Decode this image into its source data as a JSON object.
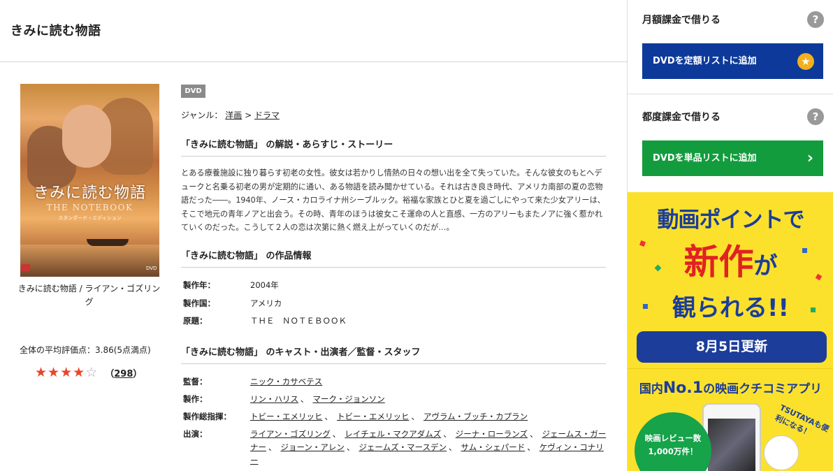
{
  "page_title": "きみに読む物語",
  "poster": {
    "title": "きみに読む物語",
    "subtitle": "THE NOTEBOOK",
    "edition": "スタンダード・エディション",
    "caption": "きみに読む物語 / ライアン・ゴズリング"
  },
  "rating": {
    "average_text": "全体の平均評価点：3.86(5点満点)",
    "average": 3.86,
    "count_open": "（",
    "count": "298",
    "count_close": "）"
  },
  "media_tag": "DVD",
  "genre": {
    "label": "ジャンル：",
    "items": [
      "洋画",
      "ドラマ"
    ],
    "sep": " > "
  },
  "synopsis": {
    "heading": "「きみに読む物語」 の解説・あらすじ・ストーリー",
    "text": "とある療養施設に独り暮らす初老の女性。彼女は若かりし情熱の日々の想い出を全て失っていた。そんな彼女のもとへデュークと名乗る初老の男が定期的に通い、ある物語を読み聞かせている。それは古き良き時代、アメリカ南部の夏の恋物語だった――。1940年、ノース・カロライナ州シーブルック。裕福な家族とひと夏を過ごしにやって来た少女アリーは、そこで地元の青年ノアと出会う。その時、青年のほうは彼女こそ運命の人と直感、一方のアリーもまたノアに強く惹かれていくのだった。こうして２人の恋は次第に熱く燃え上がっていくのだが…。"
  },
  "info": {
    "heading": "「きみに読む物語」 の作品情報",
    "rows": [
      {
        "label": "製作年：",
        "value": "2004年"
      },
      {
        "label": "製作国：",
        "value": "アメリカ"
      },
      {
        "label": "原題：",
        "value": "ＴＨＥ　ＮＯＴＥＢＯＯＫ"
      }
    ]
  },
  "cast": {
    "heading": "「きみに読む物語」 のキャスト・出演者／監督・スタッフ",
    "director_label": "監督：",
    "director": [
      "ニック・カサベテス"
    ],
    "producer_label": "製作：",
    "producers": [
      "リン・ハリス",
      "マーク・ジョンソン"
    ],
    "exec_label": "製作総指揮：",
    "execs": [
      "トビー・エメリッヒ",
      "トビー・エメリッヒ",
      "アヴラム・ブッチ・カプラン"
    ],
    "cast_label": "出演：",
    "actors": [
      "ライアン・ゴズリング",
      "レイチェル・マクアダムズ",
      "ジーナ・ローランズ",
      "ジェームス・ガーナー",
      "ジョーン・アレン",
      "ジェームズ・マースデン",
      "サム・シェパード",
      "ケヴィン・コナリー"
    ],
    "separator": "、"
  },
  "sidebar": {
    "monthly_title": "月額課金で借りる",
    "monthly_button": "DVDを定額リストに追加",
    "single_title": "都度課金で借りる",
    "single_button": "DVDを単品リストに追加",
    "help_glyph": "?",
    "colors": {
      "blue": "#0d3a9a",
      "green": "#139c3d",
      "star": "#f2b01e"
    }
  },
  "ads": {
    "banner1_line1": "動画ポイントで",
    "banner1_line2": "新作",
    "banner1_line2b": "が",
    "banner1_line3": "観られる!!",
    "banner1_update": "8月5日更新",
    "banner2_prefix": "国内",
    "banner2_no1": "No.1",
    "banner2_suffix": "の映画クチコミアプリ",
    "banner2_circle_line1": "映画レビュー数",
    "banner2_circle_line2": "1,000万件！",
    "banner2_bubble": "TSUTAYAも便利になる！"
  }
}
